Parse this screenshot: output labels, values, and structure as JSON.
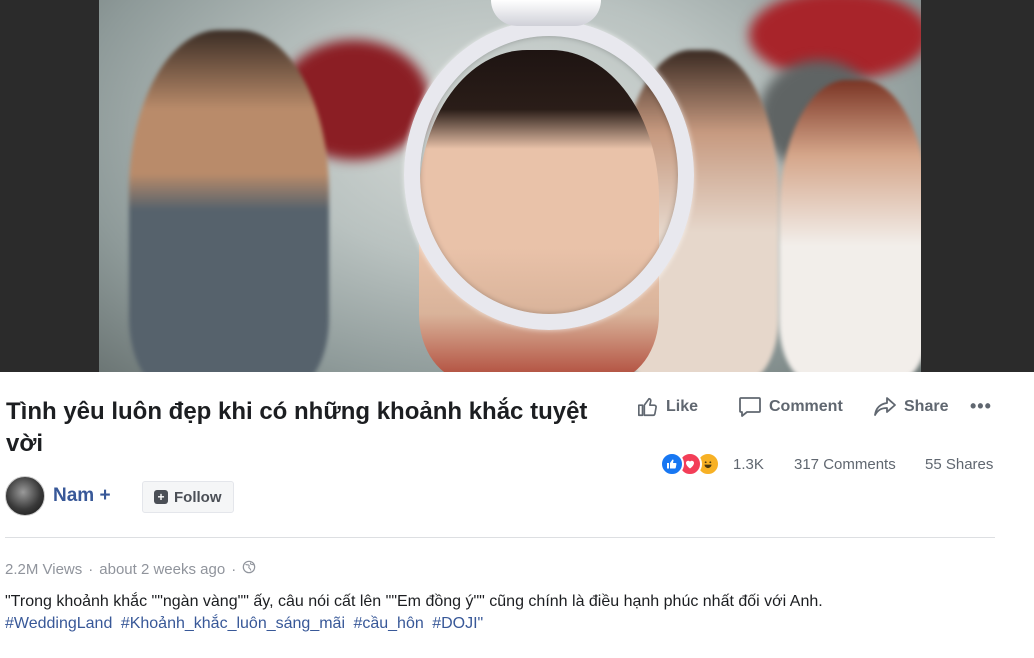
{
  "video": {
    "description_icon": "video-player"
  },
  "post": {
    "title": "Tình yêu luôn đẹp khi có những khoảnh khắc tuyệt vời",
    "author": "Nam +",
    "follow_label": "Follow",
    "views": "2.2M Views",
    "time": "about 2 weeks ago",
    "description": "\"Trong khoảnh khắc \"\"ngàn vàng\"\" ấy, câu nói cất lên \"\"Em đồng ý\"\" cũng chính là điều hạnh phúc nhất đối với Anh.",
    "hashtags": [
      "#WeddingLand",
      "#Khoảnh_khắc_luôn_sáng_mãi",
      "#cầu_hôn",
      "#DOJI\""
    ]
  },
  "actions": {
    "like": "Like",
    "comment": "Comment",
    "share": "Share",
    "more": "•••"
  },
  "stats": {
    "reactions_count": "1.3K",
    "comments": "317 Comments",
    "shares": "55 Shares",
    "reaction_types": [
      "like",
      "love",
      "haha"
    ]
  },
  "colors": {
    "accent": "#385898",
    "like_blue": "#1877f2",
    "love_red": "#f33e58",
    "haha_yellow": "#f7b125"
  }
}
